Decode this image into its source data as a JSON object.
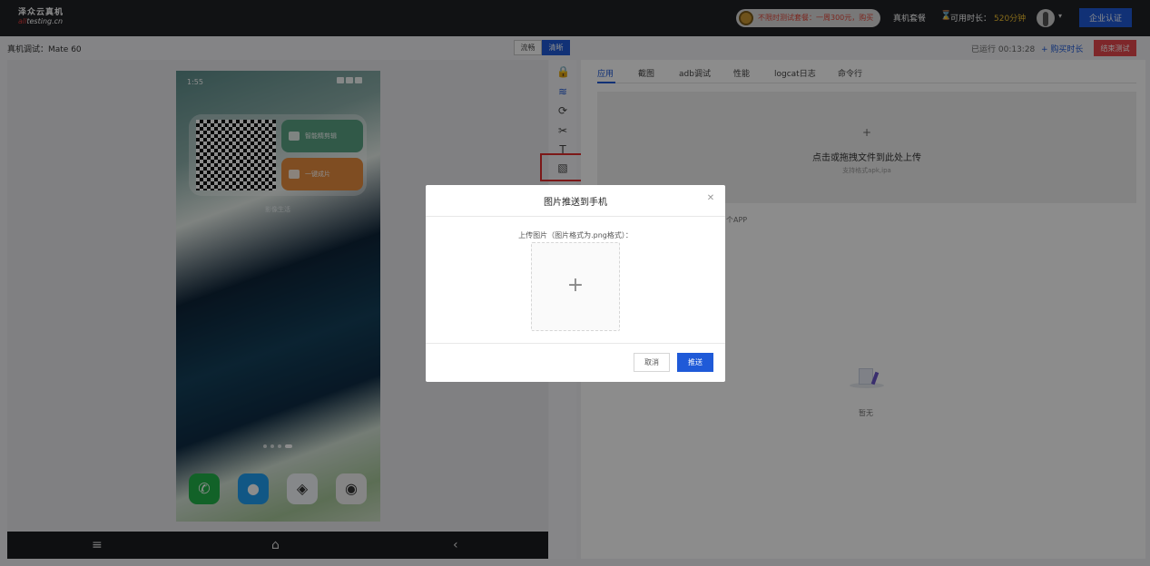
{
  "topbar": {
    "logo_cn": "泽众云真机",
    "logo_en_prefix": "ali",
    "logo_en_rest": "testing.cn",
    "promo_text": "不限时测试套餐：一周300元，购买",
    "nav_packages": "真机套餐",
    "hourglass_icon": "hourglass-icon",
    "time_label": "可用时长：",
    "time_value": "520分钟",
    "cert_button": "企业认证"
  },
  "left_panel": {
    "device_label": "真机调试：Mate 60",
    "quality_smooth": "流畅",
    "quality_clear": "清晰",
    "phone": {
      "time": "1:55",
      "qr_label": "影像生活",
      "tile_1": "智能精剪辑",
      "tile_2": "一键成片",
      "dock": [
        "phone-app-icon",
        "messages-app-icon",
        "browser-app-icon",
        "camera-app-icon"
      ]
    },
    "navbar": {
      "menu_glyph": "≡",
      "home_glyph": "⌂",
      "back_glyph": "‹"
    }
  },
  "tools": {
    "icons": [
      "lock-icon",
      "wifi-icon",
      "rotate-icon",
      "scissors-icon",
      "text-input-icon",
      "image-push-icon"
    ],
    "glyphs": [
      "🔒",
      "≋",
      "⟳",
      "✂",
      "T",
      "▧"
    ]
  },
  "right_panel": {
    "run_info": "已运行 00:13:28",
    "buy_link": "+ 购买时长",
    "end_button": "结束测试",
    "tabs": [
      "应用",
      "截图",
      "adb调试",
      "性能",
      "logcat日志",
      "命令行"
    ],
    "active_tab": 0,
    "upload": {
      "plus": "+",
      "title": "点击或拖拽文件到此处上传",
      "subtitle": "支持格式apk,ipa"
    },
    "app_count": "个APP",
    "empty_text": "暂无"
  },
  "modal": {
    "title": "图片推送到手机",
    "close_glyph": "✕",
    "label": "上传图片（图片格式为.png格式）：",
    "plus": "+",
    "cancel": "取消",
    "push": "推送"
  },
  "colors": {
    "primary": "#1f5ad8",
    "danger": "#e5484d",
    "highlight": "#e22d2d",
    "topbar": "#1f2126"
  }
}
